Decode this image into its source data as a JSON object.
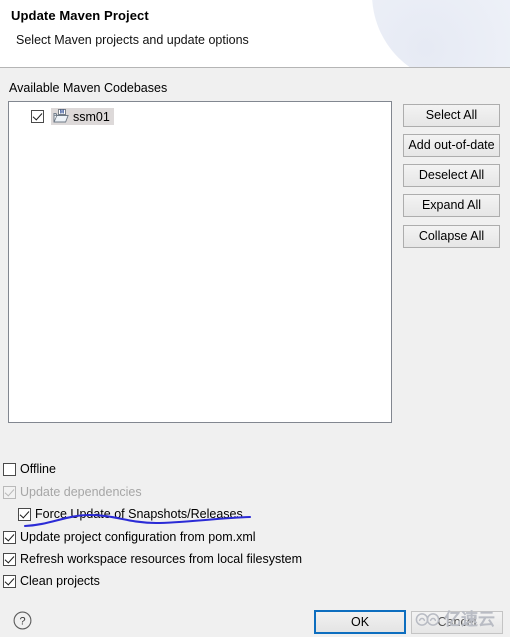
{
  "header": {
    "title": "Update Maven Project",
    "subtitle": "Select Maven projects and update options"
  },
  "tree_section": {
    "label": "Available Maven Codebases",
    "items": [
      {
        "label": "ssm01",
        "checked": true,
        "selected": true,
        "icon": "maven-project-folder-icon"
      }
    ]
  },
  "side_buttons": [
    {
      "label": "Select All"
    },
    {
      "label": "Add out-of-date"
    },
    {
      "label": "Deselect All"
    },
    {
      "label": "Expand All"
    },
    {
      "label": "Collapse All"
    }
  ],
  "options": [
    {
      "label": "Offline",
      "checked": false,
      "disabled": false,
      "indented": false
    },
    {
      "label": "Update dependencies",
      "checked": true,
      "disabled": true,
      "indented": false
    },
    {
      "label": "Force Update of Snapshots/Releases",
      "checked": true,
      "disabled": false,
      "indented": true
    },
    {
      "label": "Update project configuration from pom.xml",
      "checked": true,
      "disabled": false,
      "indented": false
    },
    {
      "label": "Refresh workspace resources from local filesystem",
      "checked": true,
      "disabled": false,
      "indented": false
    },
    {
      "label": "Clean projects",
      "checked": true,
      "disabled": false,
      "indented": false
    }
  ],
  "annotation": {
    "kind": "hand-drawn-underline",
    "color": "#2b2bd6",
    "targets": "Force Update of Snapshots/Releases"
  },
  "footer": {
    "help_icon": "question-mark-help-icon",
    "ok_label": "OK",
    "cancel_label": "Cancel"
  },
  "watermark": {
    "text": "亿速云",
    "logo": "cloud-logo-icon",
    "color": "#b9bcc4"
  },
  "colors": {
    "dialog_background": "#f0f0f0",
    "banner_background": "#ffffff",
    "banner_arc": "#eceff7",
    "panel_background": "#ffffff",
    "panel_border": "#828790",
    "selection_highlight": "#ddd9d9",
    "focus_border": "#0d6ebf",
    "disabled_text": "#a6a6a6"
  }
}
